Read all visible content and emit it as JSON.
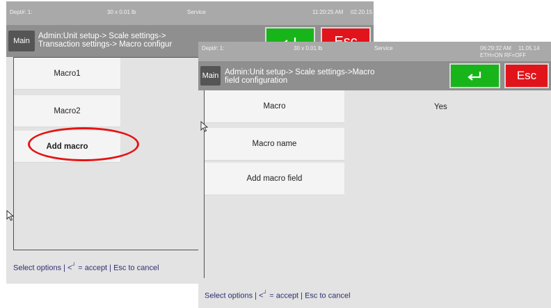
{
  "back_screen": {
    "status": {
      "dept": "Dept#: 1:",
      "capacity": "30 x 0.01 lb",
      "mode": "Service",
      "time": "11:20:25 AM",
      "date": "02.20.15"
    },
    "header": {
      "main_label": "Main",
      "title": "Admin:Unit setup-> Scale settings->\nTransaction settings-> Macro configur",
      "esc_label": "Esc"
    },
    "menu": [
      "Macro1",
      "Macro2",
      "Add macro"
    ],
    "footer": {
      "prefix": "Select options | <",
      "suffix": " = accept | Esc to cancel"
    }
  },
  "front_screen": {
    "status": {
      "dept": "Dept#: 1:",
      "capacity": "30 x 0.01 lb",
      "mode": "Service",
      "time": "06:29:32 AM",
      "date": "11.05.14",
      "network": "ETH=ON RF=OFF"
    },
    "header": {
      "main_label": "Main",
      "title": "Admin:Unit setup-> Scale settings->Macro\nfield configuration",
      "esc_label": "Esc"
    },
    "menu": [
      "Macro",
      "Macro name",
      "Add macro field"
    ],
    "macro_value": "Yes",
    "footer": {
      "prefix": "Select options | <",
      "suffix": " = accept | Esc to cancel"
    }
  },
  "annotation": {
    "highlight_color": "#e51414",
    "highlighted_item": "Add macro"
  },
  "icons": {
    "enter": "enter-return-icon",
    "cursor": "mouse-pointer-icon"
  }
}
